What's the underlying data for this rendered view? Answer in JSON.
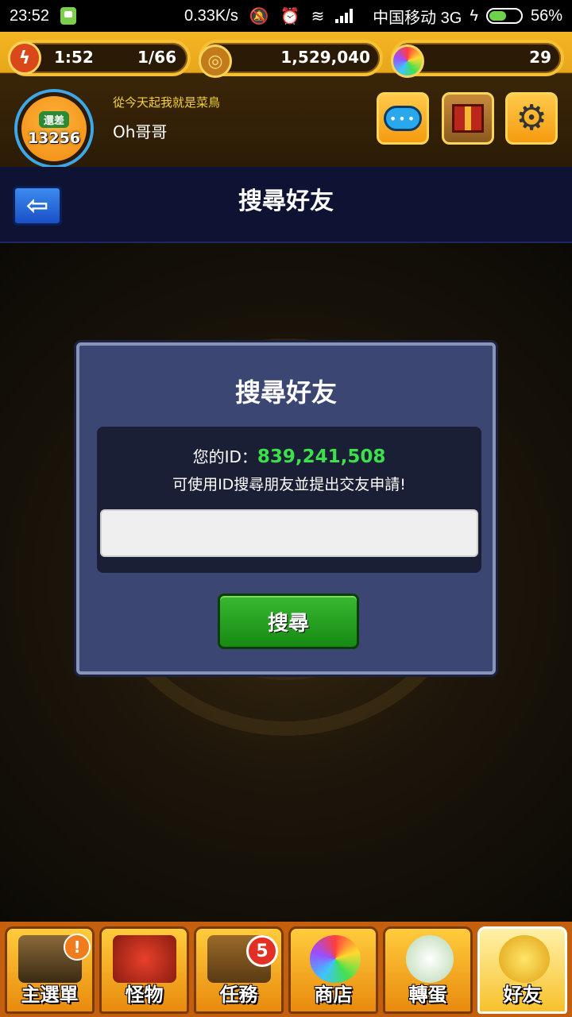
{
  "status_bar": {
    "time": "23:52",
    "speed": "0.33K/s",
    "carrier": "中国移动 3G",
    "battery": "56%",
    "battery_level": 0.56
  },
  "hud": {
    "stamina_timer": "1:52",
    "stamina_count": "1/66",
    "gold": "1,529,040",
    "orbs": "29",
    "level_label": "還差",
    "level_value": "13256",
    "motto": "從今天起我就是菜鳥",
    "player_name": "Oh哥哥"
  },
  "header": {
    "back_icon": "arrow-left-icon",
    "title": "搜尋好友"
  },
  "dialog": {
    "title": "搜尋好友",
    "id_label": "您的ID：",
    "id_value": "839,241,508",
    "hint": "可使用ID搜尋朋友並提出交友申請!",
    "search_value": "",
    "search_button": "搜尋"
  },
  "bottom_nav": {
    "items": [
      {
        "label": "主選單",
        "icon": "gate-icon"
      },
      {
        "label": "怪物",
        "icon": "monster-icon"
      },
      {
        "label": "任務",
        "icon": "book-icon",
        "badge": "5"
      },
      {
        "label": "商店",
        "icon": "orb-icon"
      },
      {
        "label": "轉蛋",
        "icon": "egg-icon"
      },
      {
        "label": "好友",
        "icon": "friends-icon"
      }
    ]
  },
  "colors": {
    "hud_gold": "#f4b522",
    "dialog_bg": "#3c4672",
    "id_green": "#3ce04a",
    "search_green": "#178a13",
    "titlebar": "#0e1233"
  }
}
